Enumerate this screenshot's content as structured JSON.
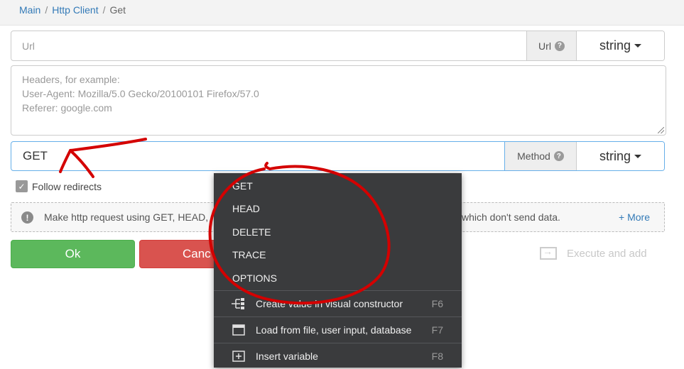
{
  "breadcrumb": {
    "items": [
      "Main",
      "Http Client"
    ],
    "separator": "/",
    "current": "Get"
  },
  "url_field": {
    "placeholder": "Url",
    "addon_label": "Url",
    "type_label": "string"
  },
  "headers_field": {
    "placeholder_lines": [
      "Headers, for example:",
      "User-Agent: Mozilla/5.0 Gecko/20100101 Firefox/57.0",
      "Referer: google.com"
    ]
  },
  "method_field": {
    "value": "GET",
    "addon_label": "Method",
    "type_label": "string"
  },
  "follow_redirects": {
    "label": "Follow redirects",
    "checked": true
  },
  "info": {
    "text_left": "Make http request using GET, HEAD,",
    "text_right": "which don't send data.",
    "more_label": "+ More"
  },
  "buttons": {
    "ok_label": "Ok",
    "cancel_label": "Canc",
    "execute_add_label": "Execute and add"
  },
  "context_menu": {
    "methods": [
      "GET",
      "HEAD",
      "DELETE",
      "TRACE",
      "OPTIONS"
    ],
    "commands": [
      {
        "label": "Create value in visual constructor",
        "shortcut": "F6",
        "icon": "tree-icon"
      },
      {
        "label": "Load from file, user input, database",
        "shortcut": "F7",
        "icon": "load-window-icon"
      },
      {
        "label": "Insert variable",
        "shortcut": "F8",
        "icon": "insert-variable-icon"
      }
    ]
  },
  "colors": {
    "link": "#337ab7",
    "ok": "#5cb85c",
    "cancel": "#d9534f",
    "menu_bg": "#3a3b3d",
    "annotation": "#d40000",
    "focus_border": "#66afe9"
  }
}
